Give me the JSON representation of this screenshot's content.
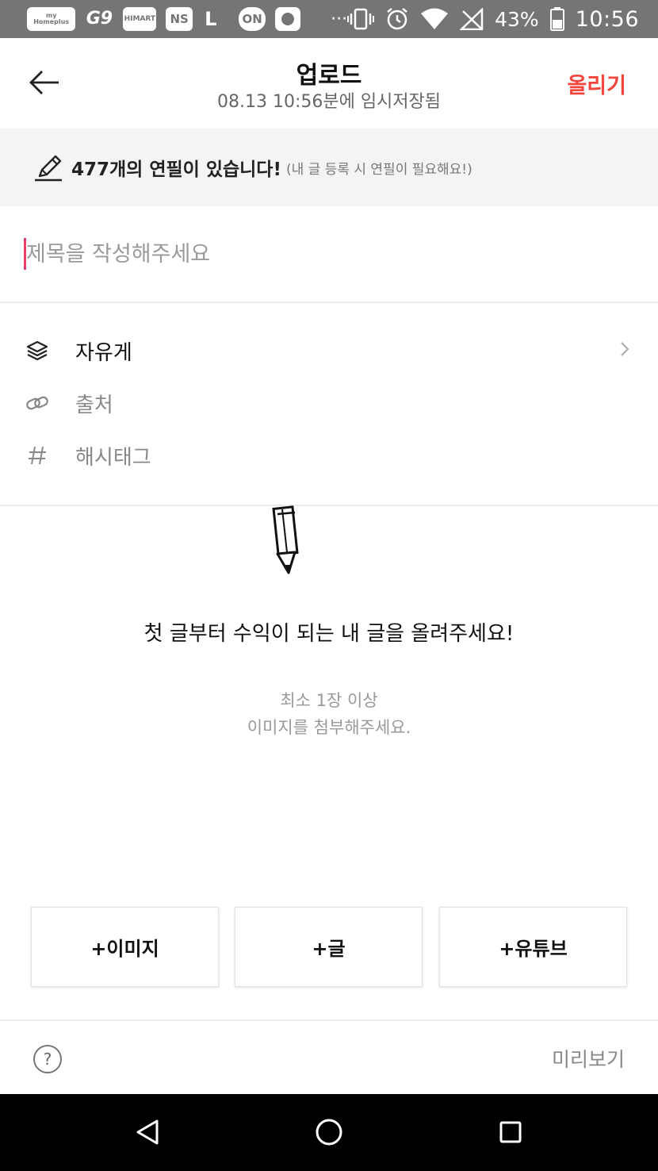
{
  "status_bar": {
    "notifications": [
      {
        "icon": "my-homeplus-icon",
        "text": "my Homeplus"
      },
      {
        "icon": "g9-icon",
        "text": "G9"
      },
      {
        "icon": "himart-icon",
        "text": "HIMART"
      },
      {
        "icon": "ns-icon",
        "text": "NS"
      },
      {
        "icon": "lotte-icon",
        "text": "L"
      },
      {
        "icon": "on-icon",
        "text": "ON"
      }
    ],
    "more": "···",
    "battery": "43%",
    "time": "10:56"
  },
  "header": {
    "title": "업로드",
    "subtitle": "08.13 10:56분에 임시저장됨",
    "upload_label": "올리기",
    "accent_color": "#f2453d"
  },
  "banner": {
    "count_text": "477개의 연필이 있습니다!",
    "note": "(내 글 등록 시 연필이 필요해요!)"
  },
  "title_input": {
    "placeholder": "제목을 작성해주세요",
    "value": "",
    "cursor_color": "#e4406a"
  },
  "meta": {
    "board": {
      "icon": "layers-icon",
      "label": "자유게"
    },
    "source": {
      "icon": "link-icon",
      "placeholder": "출처"
    },
    "hashtag": {
      "icon": "hash-icon",
      "placeholder": "해시태그"
    }
  },
  "empty_state": {
    "icon": "pencil-icon",
    "title": "첫 글부터 수익이 되는 내 글을 올려주세요!",
    "hint_line1": "최소 1장 이상",
    "hint_line2": "이미지를 첨부해주세요."
  },
  "add_buttons": {
    "image": "+이미지",
    "text": "+글",
    "youtube": "+유튜브"
  },
  "bottom_bar": {
    "help_label": "?",
    "preview_label": "미리보기"
  }
}
